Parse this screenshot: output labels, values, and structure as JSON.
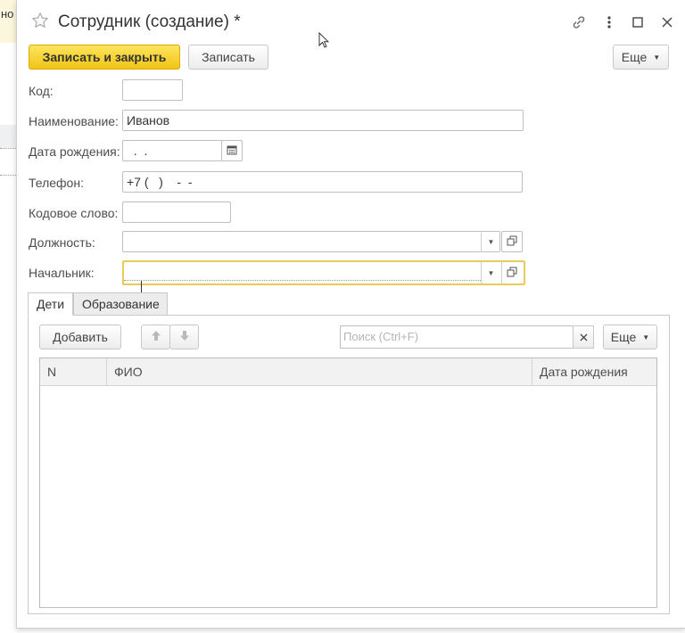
{
  "background": {
    "fragment_text": "но"
  },
  "window": {
    "title": "Сотрудник (создание) *"
  },
  "toolbar": {
    "save_close_label": "Записать и закрыть",
    "save_label": "Записать",
    "more_label": "Еще"
  },
  "form": {
    "kod": {
      "label": "Код:",
      "value": ""
    },
    "name": {
      "label": "Наименование:",
      "value": "Иванов"
    },
    "birth_date": {
      "label": "Дата рождения:",
      "value": "  .  ."
    },
    "phone": {
      "label": "Телефон:",
      "value": "+7 (   )    -  -"
    },
    "code_word": {
      "label": "Кодовое слово:",
      "value": ""
    },
    "position": {
      "label": "Должность:",
      "value": ""
    },
    "manager": {
      "label": "Начальник:",
      "value": ""
    }
  },
  "tabs": [
    {
      "label": "Дети",
      "active": true
    },
    {
      "label": "Образование",
      "active": false
    }
  ],
  "children_table": {
    "add_label": "Добавить",
    "search_placeholder": "Поиск (Ctrl+F)",
    "more_label": "Еще",
    "columns": [
      "N",
      "ФИО",
      "Дата рождения"
    ],
    "rows": []
  },
  "colors": {
    "primary_button": "#f6d02f",
    "active_field_border": "#ebcb55"
  },
  "icons": {
    "favorite": "star-outline-icon",
    "link": "link-icon",
    "menu": "kebab-menu-icon",
    "maximize": "maximize-icon",
    "close": "close-icon",
    "calendar": "calendar-icon",
    "dropdown": "triangle-down-icon",
    "open": "open-form-icon",
    "move_up": "arrow-up-icon",
    "move_down": "arrow-down-icon",
    "clear": "clear-x-icon"
  }
}
